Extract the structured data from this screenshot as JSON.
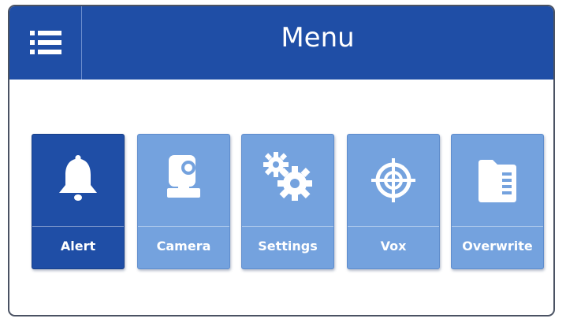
{
  "header": {
    "title": "Menu",
    "menu_icon": "hamburger-menu-icon"
  },
  "tiles": [
    {
      "label": "Alert",
      "icon": "bell-icon",
      "active": true
    },
    {
      "label": "Camera",
      "icon": "camera-icon",
      "active": false
    },
    {
      "label": "Settings",
      "icon": "gears-icon",
      "active": false
    },
    {
      "label": "Vox",
      "icon": "crosshair-icon",
      "active": false
    },
    {
      "label": "Overwrite",
      "icon": "sd-card-icon",
      "active": false
    }
  ],
  "colors": {
    "header_bg": "#1f4ea6",
    "active_tile": "#1f4ea6",
    "inactive_tile": "#74a2de",
    "text": "#ffffff"
  }
}
